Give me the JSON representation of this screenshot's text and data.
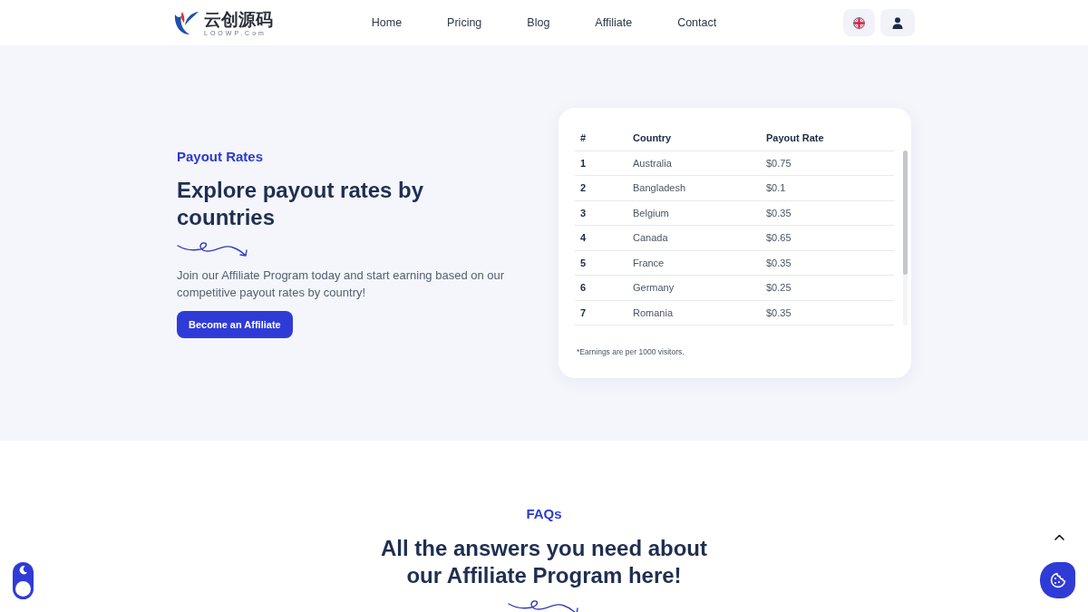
{
  "header": {
    "logo": {
      "name": "云创源码",
      "tagline": "LOOWP.Com"
    },
    "nav": [
      {
        "label": "Home"
      },
      {
        "label": "Pricing"
      },
      {
        "label": "Blog"
      },
      {
        "label": "Affiliate"
      },
      {
        "label": "Contact"
      }
    ]
  },
  "hero": {
    "eyebrow": "Payout Rates",
    "title": "Explore payout rates by countries",
    "description": "Join our Affiliate Program today and start earning based on our competitive payout rates by country!",
    "button": "Become an Affiliate"
  },
  "payout_table": {
    "columns": [
      "#",
      "Country",
      "Payout Rate"
    ],
    "rows": [
      [
        "1",
        "Australia",
        "$0.75"
      ],
      [
        "2",
        "Bangladesh",
        "$0.1"
      ],
      [
        "3",
        "Belgium",
        "$0.35"
      ],
      [
        "4",
        "Canada",
        "$0.65"
      ],
      [
        "5",
        "France",
        "$0.35"
      ],
      [
        "6",
        "Germany",
        "$0.25"
      ],
      [
        "7",
        "Romania",
        "$0.35"
      ]
    ],
    "footnote": "*Earnings are per 1000 visitors."
  },
  "faq": {
    "eyebrow": "FAQs",
    "title": "All the answers you need about our Affiliate Program here!"
  },
  "theme_toggle": {
    "on": false
  }
}
